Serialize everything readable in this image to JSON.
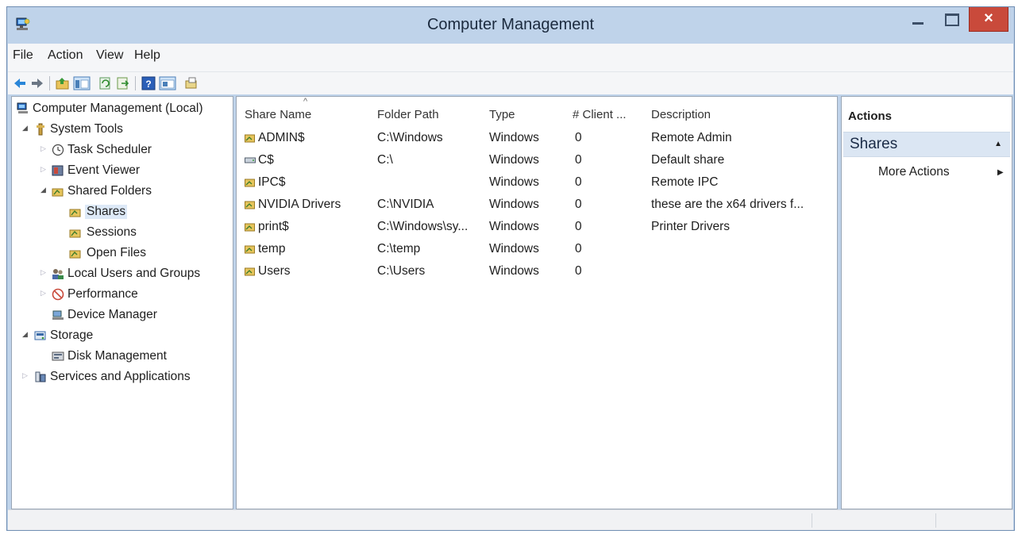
{
  "window": {
    "title": "Computer Management",
    "close_glyph": "×",
    "icons": [
      "computer-management-icon",
      "minimize-icon",
      "maximize-icon",
      "close-icon"
    ]
  },
  "menu": {
    "items": [
      "File",
      "Action",
      "View",
      "Help"
    ]
  },
  "toolbar": {
    "icons": [
      "back-arrow-icon",
      "forward-arrow-icon",
      "up-folder-icon",
      "show-hide-console-tree-icon",
      "refresh-icon",
      "export-list-icon",
      "help-icon",
      "properties-icon",
      "new-share-icon"
    ]
  },
  "tree": {
    "items": [
      {
        "label": "Computer Management (Local)",
        "icon": "computer-icon",
        "depth": 0,
        "expander": ""
      },
      {
        "label": "System Tools",
        "icon": "tools-icon",
        "depth": 1,
        "expander": "expanded"
      },
      {
        "label": "Task Scheduler",
        "icon": "clock-icon",
        "depth": 2,
        "expander": "collapsed"
      },
      {
        "label": "Event Viewer",
        "icon": "event-viewer-icon",
        "depth": 2,
        "expander": "collapsed"
      },
      {
        "label": "Shared Folders",
        "icon": "shared-folder-icon",
        "depth": 2,
        "expander": "expanded"
      },
      {
        "label": "Shares",
        "icon": "shared-folder-icon",
        "depth": 3,
        "expander": "",
        "selected": true
      },
      {
        "label": "Sessions",
        "icon": "shared-folder-icon",
        "depth": 3,
        "expander": ""
      },
      {
        "label": "Open Files",
        "icon": "shared-folder-icon",
        "depth": 3,
        "expander": ""
      },
      {
        "label": "Local Users and Groups",
        "icon": "users-icon",
        "depth": 2,
        "expander": "collapsed"
      },
      {
        "label": "Performance",
        "icon": "performance-icon",
        "depth": 2,
        "expander": "collapsed"
      },
      {
        "label": "Device Manager",
        "icon": "device-manager-icon",
        "depth": 2,
        "expander": ""
      },
      {
        "label": "Storage",
        "icon": "storage-icon",
        "depth": 1,
        "expander": "expanded"
      },
      {
        "label": "Disk Management",
        "icon": "disk-icon",
        "depth": 2,
        "expander": ""
      },
      {
        "label": "Services and Applications",
        "icon": "services-icon",
        "depth": 1,
        "expander": "collapsed"
      }
    ],
    "expander_glyphs": {
      "expanded": "◢",
      "collapsed": "▷"
    }
  },
  "list": {
    "sort_indicator": "^",
    "columns": [
      "Share Name",
      "Folder Path",
      "Type",
      "# Client ...",
      "Description"
    ],
    "rows": [
      [
        "ADMIN$",
        "C:\\Windows",
        "Windows",
        "0",
        "Remote Admin"
      ],
      [
        "C$",
        "C:\\",
        "Windows",
        "0",
        "Default share"
      ],
      [
        "IPC$",
        "",
        "Windows",
        "0",
        "Remote IPC"
      ],
      [
        "NVIDIA Drivers",
        "C:\\NVIDIA",
        "Windows",
        "0",
        "these are the x64 drivers f..."
      ],
      [
        "print$",
        "C:\\Windows\\sy...",
        "Windows",
        "0",
        "Printer Drivers"
      ],
      [
        "temp",
        "C:\\temp",
        "Windows",
        "0",
        ""
      ],
      [
        "Users",
        "C:\\Users",
        "Windows",
        "0",
        ""
      ]
    ],
    "row_icons": [
      "shared-folder-icon",
      "drive-share-icon",
      "shared-folder-icon",
      "shared-folder-icon",
      "shared-folder-icon",
      "shared-folder-icon",
      "shared-folder-icon"
    ]
  },
  "actions": {
    "heading": "Actions",
    "group_label": "Shares",
    "group_caret": "▲",
    "item_label": "More Actions",
    "item_arrow": "▶"
  },
  "colors": {
    "title_bar": "#bfd3ea",
    "close_button": "#c94a3b",
    "selection": "#dde9f7",
    "actions_group": "#dbe6f3"
  }
}
